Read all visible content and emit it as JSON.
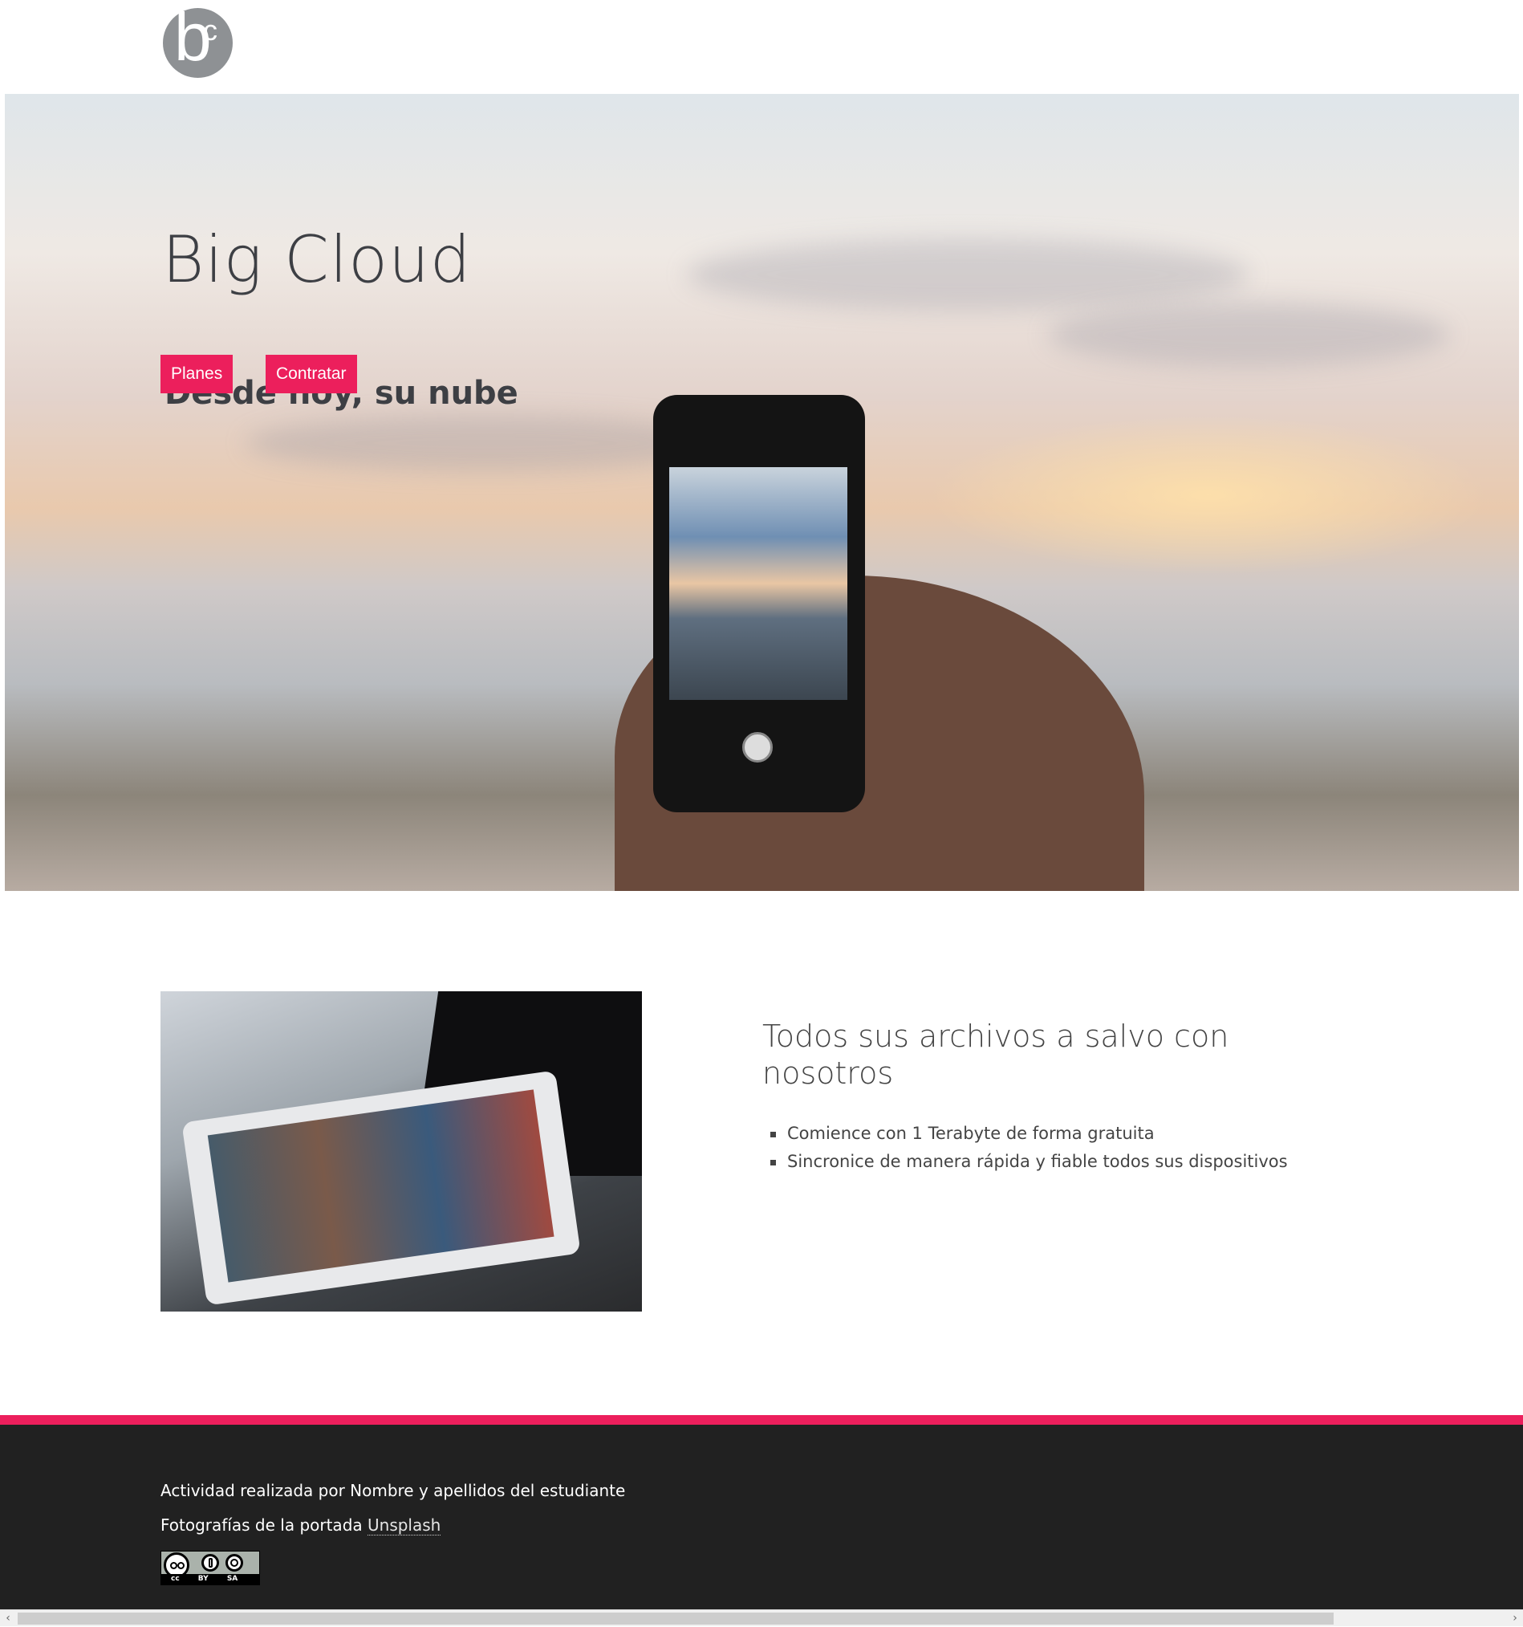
{
  "header": {
    "logo_text": "bc"
  },
  "hero": {
    "title": "Big Cloud",
    "subtitle": "Desde hoy, su nube",
    "buttons": [
      {
        "label": "Planes"
      },
      {
        "label": "Contratar"
      }
    ]
  },
  "feature": {
    "title": "Todos sus archivos a salvo con nosotros",
    "bullets": [
      "Comience con 1 Terabyte de forma gratuita",
      "Sincronice de manera rápida y fiable todos sus dispositivos"
    ]
  },
  "footer": {
    "line1": "Actividad realizada por Nombre y apellidos del estudiante",
    "line2_prefix": "Fotografías de la portada ",
    "line2_link": "Unsplash",
    "license_badge": "cc BY SA"
  },
  "colors": {
    "accent": "#ec1f5c",
    "footer_bg": "#212121",
    "text": "#444444"
  },
  "scrollbar": {
    "left_arrow": "‹",
    "right_arrow": "›"
  }
}
